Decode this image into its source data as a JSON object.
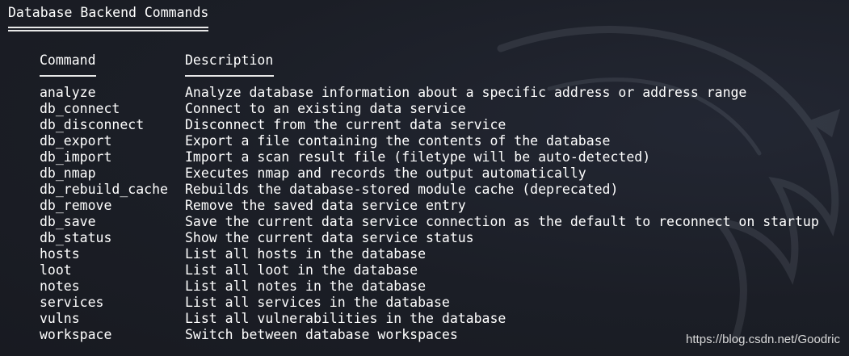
{
  "section_title": "Database Backend Commands",
  "columns": {
    "command": "Command",
    "description": "Description"
  },
  "rows": [
    {
      "command": "analyze",
      "description": "Analyze database information about a specific address or address range"
    },
    {
      "command": "db_connect",
      "description": "Connect to an existing data service"
    },
    {
      "command": "db_disconnect",
      "description": "Disconnect from the current data service"
    },
    {
      "command": "db_export",
      "description": "Export a file containing the contents of the database"
    },
    {
      "command": "db_import",
      "description": "Import a scan result file (filetype will be auto-detected)"
    },
    {
      "command": "db_nmap",
      "description": "Executes nmap and records the output automatically"
    },
    {
      "command": "db_rebuild_cache",
      "description": "Rebuilds the database-stored module cache (deprecated)"
    },
    {
      "command": "db_remove",
      "description": "Remove the saved data service entry"
    },
    {
      "command": "db_save",
      "description": "Save the current data service connection as the default to reconnect on startup"
    },
    {
      "command": "db_status",
      "description": "Show the current data service status"
    },
    {
      "command": "hosts",
      "description": "List all hosts in the database"
    },
    {
      "command": "loot",
      "description": "List all loot in the database"
    },
    {
      "command": "notes",
      "description": "List all notes in the database"
    },
    {
      "command": "services",
      "description": "List all services in the database"
    },
    {
      "command": "vulns",
      "description": "List all vulnerabilities in the database"
    },
    {
      "command": "workspace",
      "description": "Switch between database workspaces"
    }
  ],
  "watermark": "https://blog.csdn.net/Goodric",
  "colors": {
    "background": "#1c1f27",
    "text": "#ffffff"
  },
  "icons": {
    "background_art": "kali-dragon-icon"
  }
}
